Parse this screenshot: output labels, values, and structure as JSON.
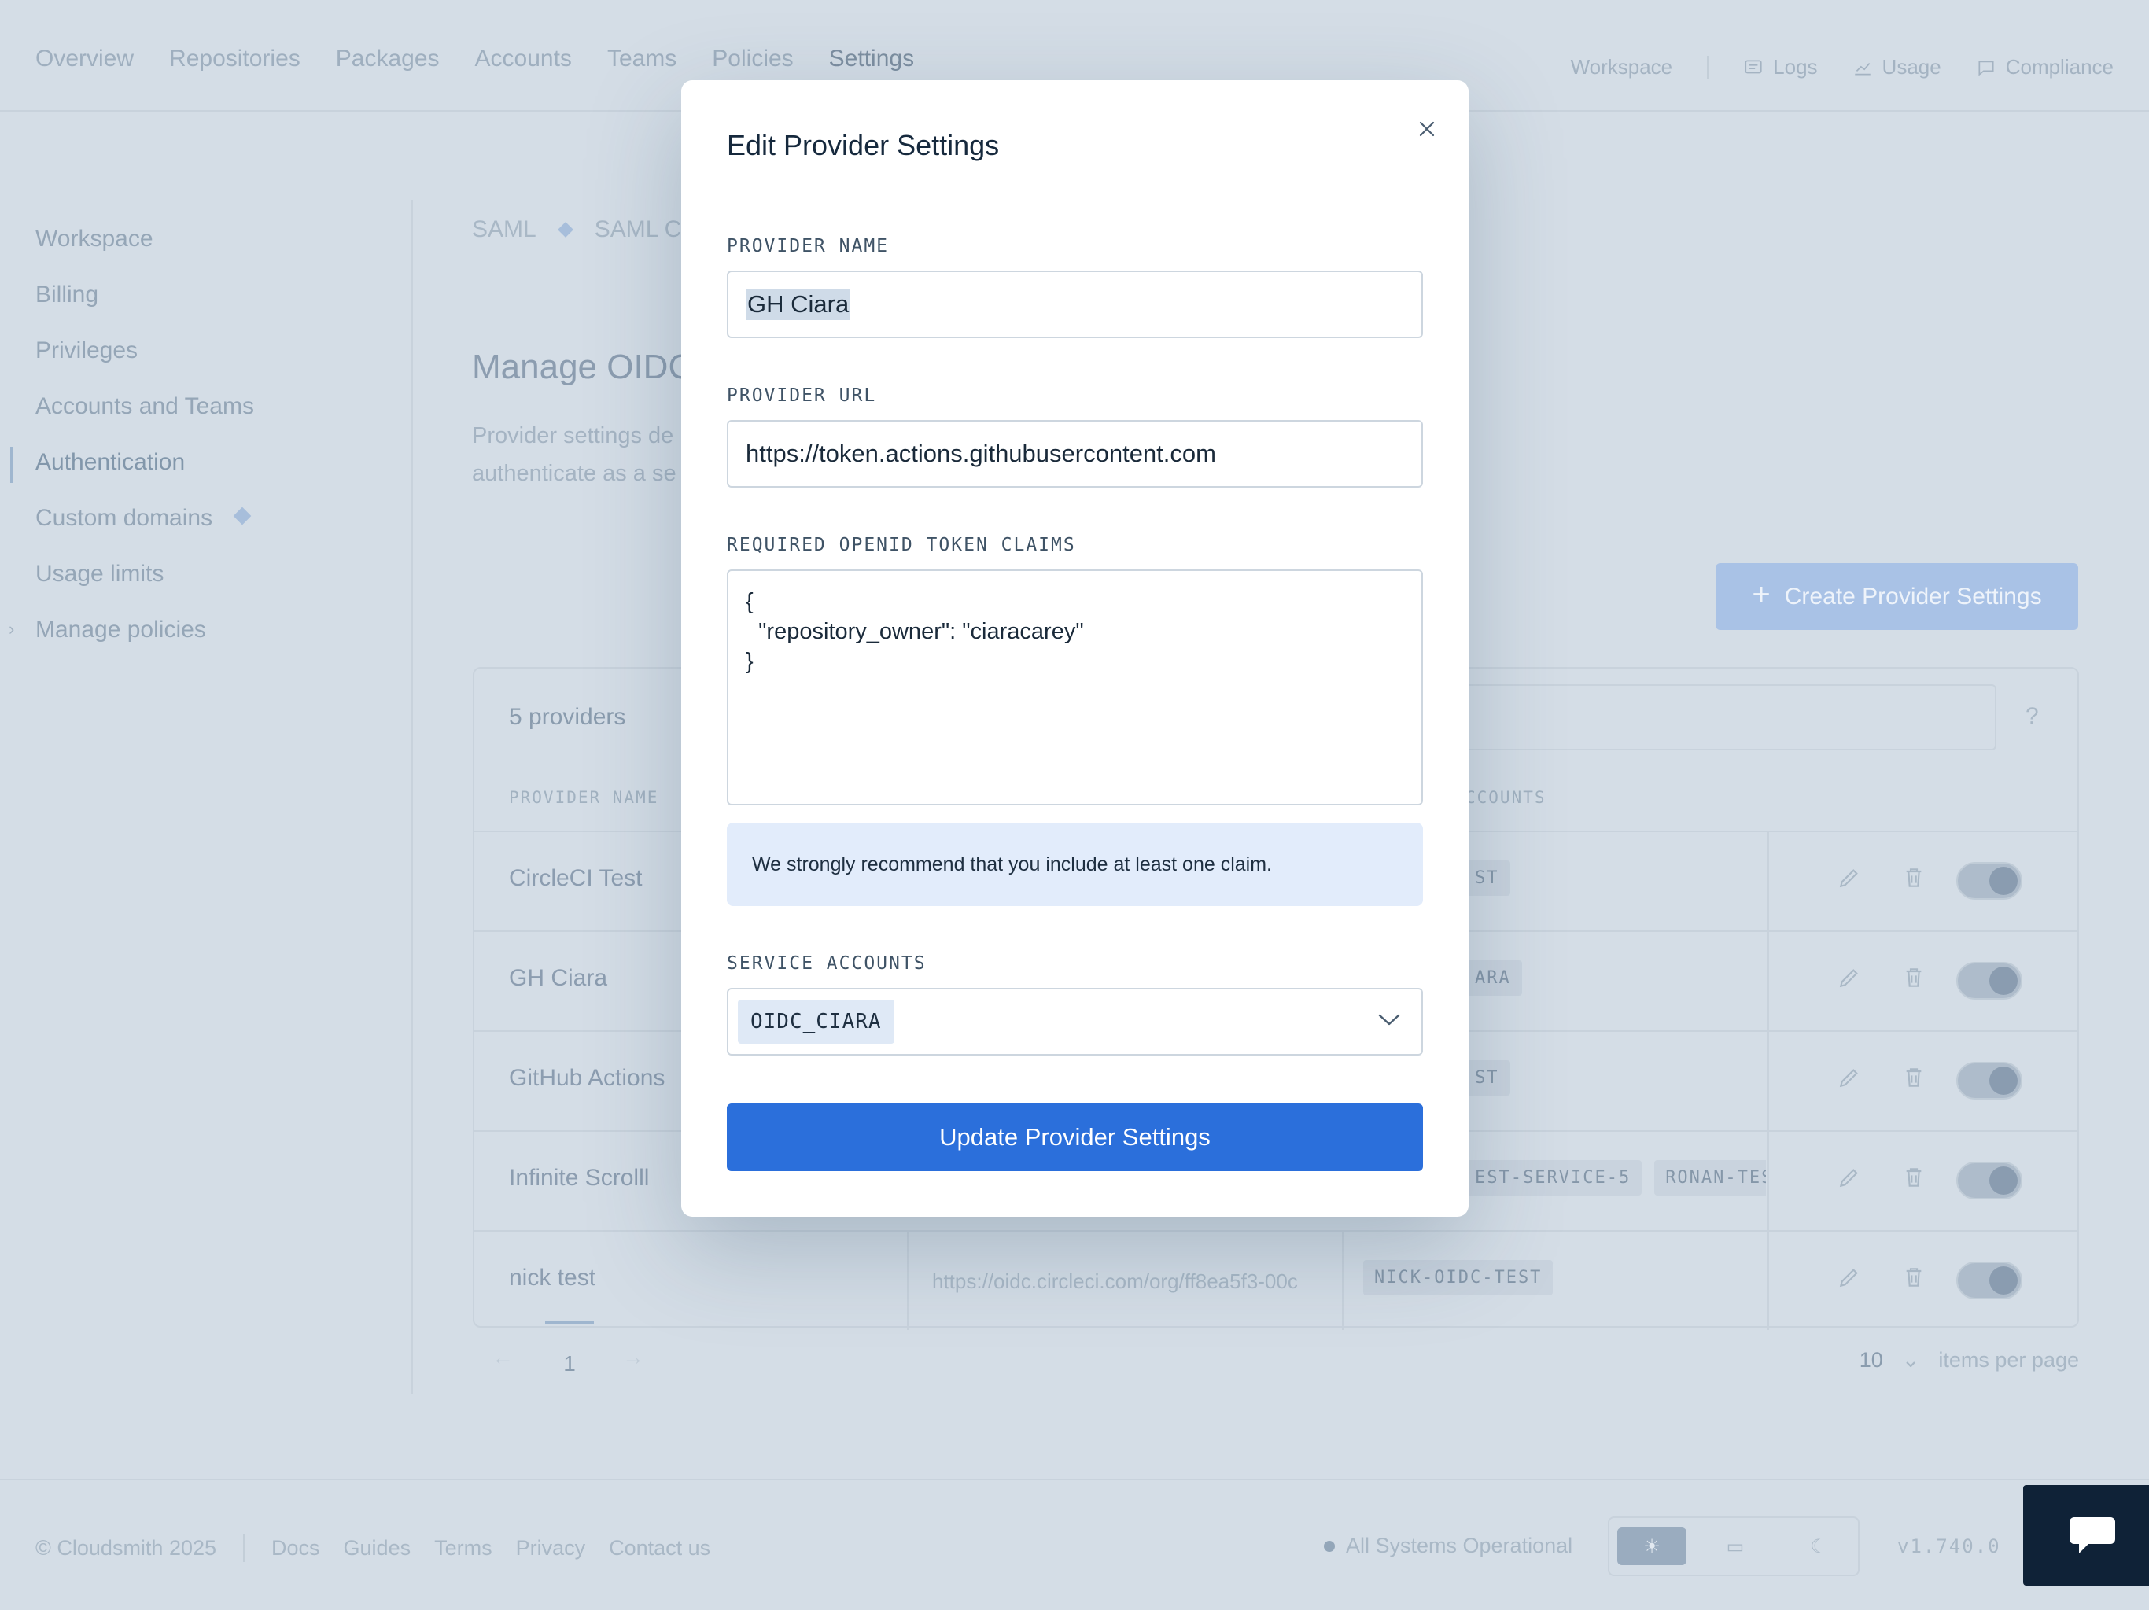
{
  "topnav": {
    "items": [
      "Overview",
      "Repositories",
      "Packages",
      "Accounts",
      "Teams",
      "Policies",
      "Settings"
    ],
    "active": "Settings",
    "right": {
      "workspace": "Workspace",
      "logs": "Logs",
      "usage": "Usage",
      "compliance": "Compliance"
    }
  },
  "sidebar": {
    "items": [
      {
        "label": "Workspace"
      },
      {
        "label": "Billing"
      },
      {
        "label": "Privileges"
      },
      {
        "label": "Accounts and Teams"
      },
      {
        "label": "Authentication"
      },
      {
        "label": "Custom domains"
      },
      {
        "label": "Usage limits"
      },
      {
        "label": "Manage policies"
      }
    ]
  },
  "breadcrumb": {
    "first": "SAML",
    "second": "SAML C"
  },
  "main": {
    "title": "Manage OIDC",
    "desc_line1": "Provider settings de",
    "desc_line2": "authenticate as a se",
    "create_button": "Create Provider Settings"
  },
  "table": {
    "count": "5 providers",
    "col_name": "PROVIDER NAME",
    "col_accounts": "CCOUNTS",
    "help": "?",
    "rows": [
      {
        "name": "CircleCI Test",
        "url": "",
        "tags": [
          "ST"
        ]
      },
      {
        "name": "GH Ciara",
        "url": "",
        "tags": [
          "ARA"
        ]
      },
      {
        "name": "GitHub Actions",
        "url": "",
        "tags": [
          "ST"
        ]
      },
      {
        "name": "Infinite Scrolll",
        "url": "",
        "tags": [
          "EST-SERVICE-5",
          "RONAN-TEST"
        ]
      },
      {
        "name": "nick test",
        "url": "https://oidc.circleci.com/org/ff8ea5f3-00c",
        "tags": [
          "NICK-OIDC-TEST"
        ]
      }
    ]
  },
  "pager": {
    "page": "1",
    "per_page": "10",
    "per_page_label": "items per page"
  },
  "footer": {
    "copyright": "© Cloudsmith 2025",
    "links": [
      "Docs",
      "Guides",
      "Terms",
      "Privacy",
      "Contact us"
    ],
    "status": "All Systems Operational",
    "version": "v1.740.0"
  },
  "modal": {
    "title": "Edit Provider Settings",
    "provider_name_label": "PROVIDER NAME",
    "provider_name_value": "GH Ciara",
    "provider_url_label": "PROVIDER URL",
    "provider_url_value": "https://token.actions.githubusercontent.com",
    "claims_label": "REQUIRED OPENID TOKEN CLAIMS",
    "claims_value": "{\n  \"repository_owner\": \"ciaracarey\"\n}",
    "notice": "We strongly recommend that you include at least one claim.",
    "service_accounts_label": "SERVICE ACCOUNTS",
    "service_account_chip": "OIDC_CIARA",
    "submit_label": "Update Provider Settings"
  },
  "colors": {
    "primary": "#2b6fdb",
    "overlay": "#d4dde6",
    "notice_bg": "#e2ecfb"
  }
}
